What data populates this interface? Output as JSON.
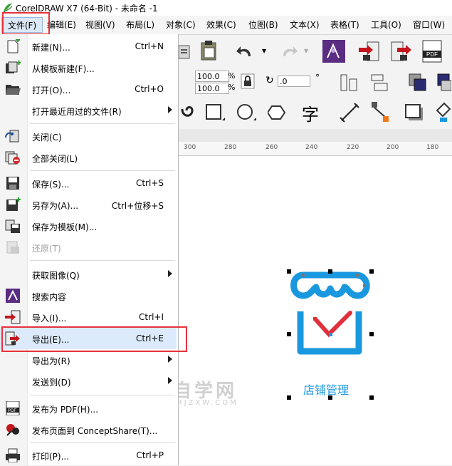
{
  "window": {
    "title": "CorelDRAW X7 (64-Bit) - 未命名 -1"
  },
  "menubar": [
    {
      "label": "文件(F)"
    },
    {
      "label": "编辑(E)"
    },
    {
      "label": "视图(V)"
    },
    {
      "label": "布局(L)"
    },
    {
      "label": "对象(C)"
    },
    {
      "label": "效果(C)"
    },
    {
      "label": "位图(B)"
    },
    {
      "label": "文本(X)"
    },
    {
      "label": "表格(T)"
    },
    {
      "label": "工具(O)"
    },
    {
      "label": "窗口(W)"
    }
  ],
  "file_menu": [
    {
      "label": "新建(N)...",
      "shortcut": "Ctrl+N",
      "icon": "new-doc-icon"
    },
    {
      "label": "从模板新建(F)...",
      "shortcut": "",
      "icon": "template-new-icon"
    },
    {
      "label": "打开(O)...",
      "shortcut": "Ctrl+O",
      "icon": "folder-open-icon"
    },
    {
      "label": "打开最近用过的文件(R)",
      "shortcut": "",
      "icon": ""
    },
    {
      "label": "关闭(C)",
      "shortcut": "",
      "icon": "close-doc-icon"
    },
    {
      "label": "全部关闭(L)",
      "shortcut": "",
      "icon": "close-all-icon"
    },
    {
      "label": "保存(S)...",
      "shortcut": "Ctrl+S",
      "icon": "save-icon"
    },
    {
      "label": "另存为(A)...",
      "shortcut": "Ctrl+位移+S",
      "icon": "save-as-icon"
    },
    {
      "label": "保存为模板(M)...",
      "shortcut": "",
      "icon": "save-template-icon"
    },
    {
      "label": "还原(T)",
      "shortcut": "",
      "icon": "revert-icon"
    },
    {
      "label": "获取图像(Q)",
      "shortcut": "",
      "icon": ""
    },
    {
      "label": "搜索内容",
      "shortcut": "",
      "icon": "search-content-icon"
    },
    {
      "label": "导入(I)...",
      "shortcut": "Ctrl+I",
      "icon": "import-icon"
    },
    {
      "label": "导出(E)...",
      "shortcut": "Ctrl+E",
      "icon": "export-icon"
    },
    {
      "label": "导出为(R)",
      "shortcut": "",
      "icon": ""
    },
    {
      "label": "发送到(D)",
      "shortcut": "",
      "icon": ""
    },
    {
      "label": "发布为 PDF(H)...",
      "shortcut": "",
      "icon": "pdf-icon"
    },
    {
      "label": "发布页面到 ConceptShare(T)...",
      "shortcut": "",
      "icon": "conceptshare-icon"
    },
    {
      "label": "打印(P)...",
      "shortcut": "Ctrl+P",
      "icon": "print-icon"
    }
  ],
  "property_bar": {
    "scale_x": "100.0",
    "scale_y": "100.0",
    "percent": "%",
    "rotation": ".0",
    "degree": "°"
  },
  "ruler": {
    "ticks": [
      "300",
      "280",
      "260",
      "240",
      "220",
      "200",
      "180"
    ]
  },
  "canvas": {
    "shape_label": "店铺管理"
  },
  "watermark": {
    "text": "软件自学网",
    "sub": "WWW.RJZXW.COM"
  },
  "colors": {
    "accent_blue": "#1a98df",
    "check_red": "#e0303a",
    "highlight_border": "#e8323c"
  }
}
